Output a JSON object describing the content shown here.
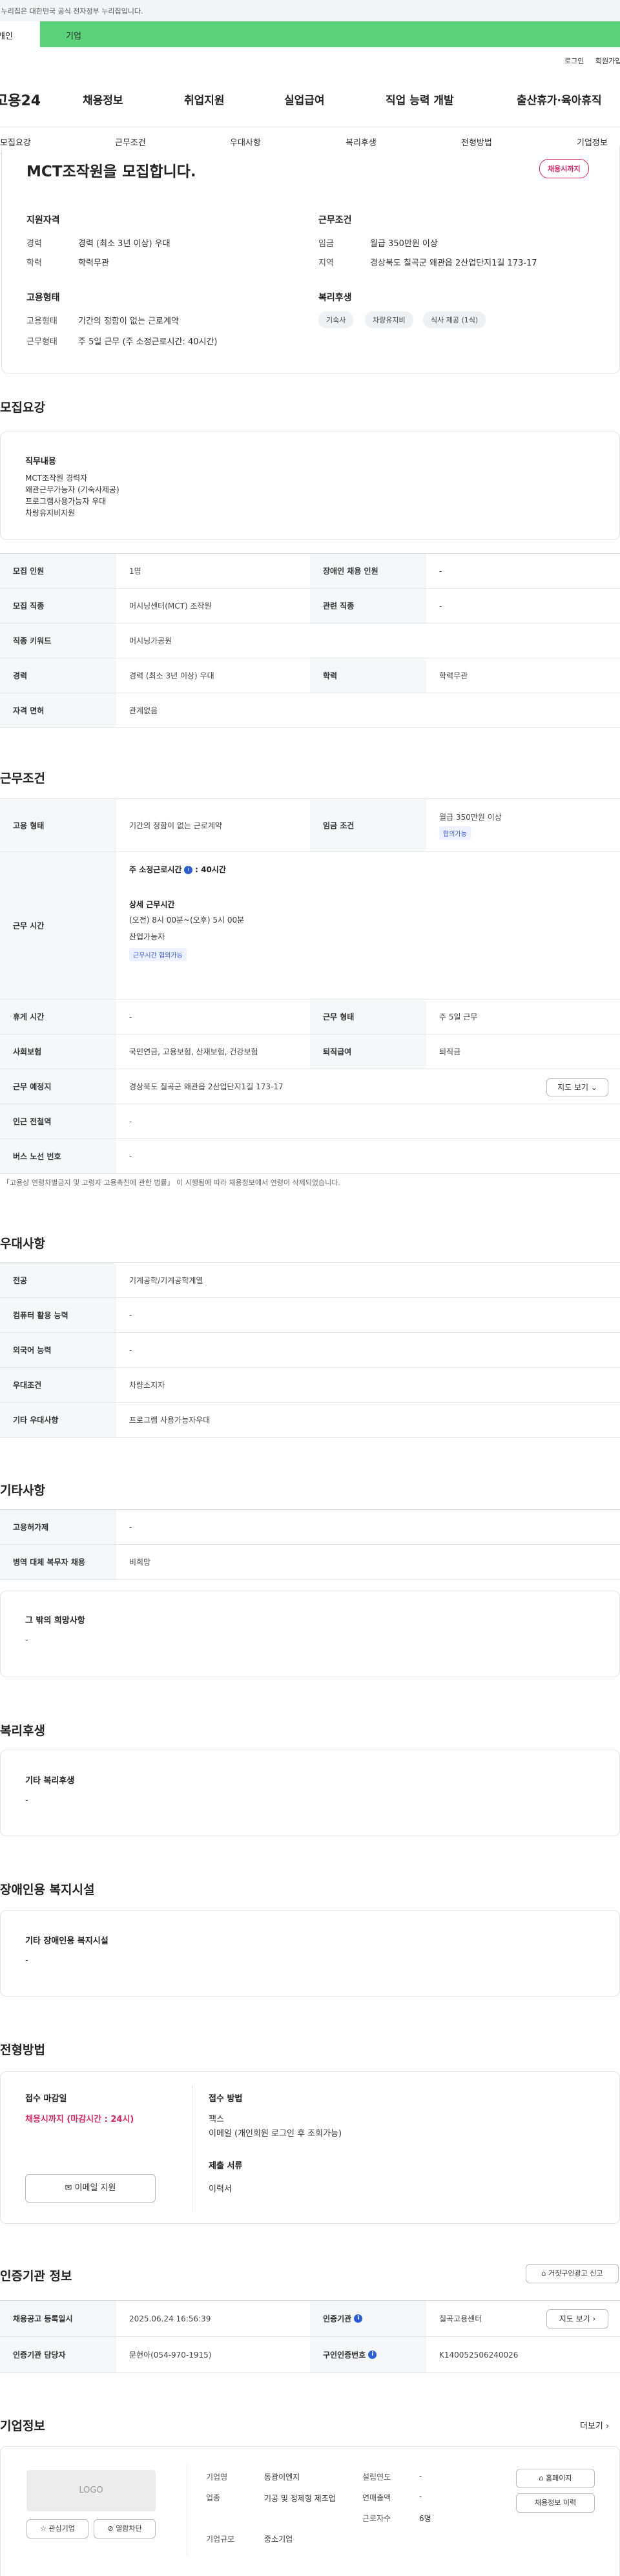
{
  "gov_bar": {
    "text": "이 누리집은 대한민국 공식 전자정부 누리집입니다."
  },
  "site_tabs": [
    "개인",
    "기업"
  ],
  "util_links": [
    "로그인",
    "회원가입"
  ],
  "gnb": {
    "logo": "고용24",
    "menus": [
      "채용정보",
      "취업지원",
      "실업급여",
      "직업 능력 개발",
      "출산휴가·육아휴직"
    ]
  },
  "anchor_tabs": [
    "모집요강",
    "근무조건",
    "우대사항",
    "복리후생",
    "전형방법",
    "기업정보"
  ],
  "summary": {
    "title": "MCT조작원을 모집합니다.",
    "badge": "채용시까지",
    "qual": {
      "heading": "지원자격",
      "rows": [
        {
          "label": "경력",
          "value": "경력 (최소 3년 이상) 우대"
        },
        {
          "label": "학력",
          "value": "학력무관"
        }
      ]
    },
    "cond": {
      "heading": "근무조건",
      "rows": [
        {
          "label": "임금",
          "value": "월급 350만원 이상"
        },
        {
          "label": "지역",
          "value": "경상북도 칠곡군 왜관읍 2산업단지1길 173-17"
        }
      ]
    },
    "emp": {
      "heading": "고용형태",
      "rows": [
        {
          "label": "고용형태",
          "value": "기간의 정함이 없는 근로계약"
        },
        {
          "label": "근무형태",
          "value": "주 5일 근무 (주 소정근로시간: 40시간)"
        }
      ]
    },
    "welfare": {
      "heading": "복리후생",
      "chips": [
        "기숙사",
        "차량유지비",
        "식사 제공 (1식)"
      ]
    }
  },
  "recruit": {
    "heading": "모집요강",
    "duty_title": "직무내용",
    "duty_lines": [
      "MCT조작원 경력자",
      "왜관근무가능자 (기숙사제공)",
      "프로그램사용가능자 우대",
      "차량유지비지원"
    ],
    "rows": [
      {
        "th1": "모집 인원",
        "td1": "1명",
        "th2": "장애인 채용 인원",
        "td2": "-"
      },
      {
        "th1": "모집 직종",
        "td1": "머시닝센터(MCT) 조작원",
        "th2": "관련 직종",
        "td2": "-"
      },
      {
        "th1": "직종 키워드",
        "td1": "머시닝가공원"
      },
      {
        "th1": "경력",
        "td1": "경력 (최소 3년 이상) 우대",
        "th2": "학력",
        "td2": "학력무관"
      },
      {
        "th1": "자격 면허",
        "td1": "관계없음"
      }
    ]
  },
  "work": {
    "heading": "근무조건",
    "emp_type_label": "고용 형태",
    "emp_type": "기간의 정함이 없는 근로계약",
    "wage_label": "임금 조건",
    "wage": "월급 350만원 이상",
    "wage_tag": "협의가능",
    "hours_label": "근무 시간",
    "hours_week": "주 소정근로시간",
    "hours_value": ": 40시간",
    "hours_detail_title": "상세 근무시간",
    "hours_detail": "(오전) 8시 00분~(오후) 5시 00분",
    "hours_extra": "잔업가능자",
    "hours_tag": "근무시간 협의가능",
    "rows": [
      {
        "th1": "휴게 시간",
        "td1": "-",
        "th2": "근무 형태",
        "td2": "주 5일 근무"
      },
      {
        "th1": "사회보험",
        "td1": "국민연금, 고용보험, 산재보험, 건강보험",
        "th2": "퇴직급여",
        "td2": "퇴직금"
      }
    ],
    "place_label": "근무 예정지",
    "place": "경상북도 칠곡군 왜관읍 2산업단지1길 173-17",
    "map_btn": "지도 보기",
    "station_label": "인근 전철역",
    "station": "-",
    "bus_label": "버스 노선 번호",
    "bus": "-",
    "note": "「고용상 연령차별금지 및 고령자 고용촉진에 관한 법률」 이 시행됨에 따라 채용정보에서 연령이 삭제되었습니다."
  },
  "prefer": {
    "heading": "우대사항",
    "rows": [
      {
        "th": "전공",
        "td": "기계공학/기계공학계열"
      },
      {
        "th": "컴퓨터 활용 능력",
        "td": "-"
      },
      {
        "th": "외국어 능력",
        "td": "-"
      },
      {
        "th": "우대조건",
        "td": "차량소지자"
      },
      {
        "th": "기타 우대사항",
        "td": "프로그램 사용가능자우대"
      }
    ]
  },
  "etc": {
    "heading": "기타사항",
    "rows": [
      {
        "th": "고용허가제",
        "td": "-"
      },
      {
        "th": "병역 대체 복무자 채용",
        "td": "비희망"
      }
    ],
    "box_title": "그 밖의 희망사항",
    "box_value": "-"
  },
  "benefit": {
    "heading": "복리후생",
    "box_title": "기타 복리후생",
    "box_value": "-"
  },
  "disabled": {
    "heading": "장애인용 복지시설",
    "box_title": "기타 장애인용 복지시설",
    "box_value": "-"
  },
  "process": {
    "heading": "전형방법",
    "deadline_title": "접수 마감일",
    "deadline": "채용시까지 (마감시간 : 24시)",
    "email_btn": "이메일 지원",
    "method_title": "접수 방법",
    "methods": [
      "팩스",
      "이메일 (개인회원 로그인 후 조회가능)"
    ],
    "docs_title": "제출 서류",
    "docs": "이력서"
  },
  "agency": {
    "heading": "인증기관 정보",
    "report_btn": "거짓구인광고 신고",
    "rows": [
      {
        "th1": "채용공고 등록일시",
        "td1": "2025.06.24 16:56:39",
        "th2": "인증기관",
        "td2": "칠곡고용센터",
        "btn": "지도 보기"
      },
      {
        "th1": "인증기관 담당자",
        "td1": "문현아(054-970-1915)",
        "th2": "구인인증번호",
        "td2": "K140052506240026"
      }
    ]
  },
  "company": {
    "heading": "기업정보",
    "more": "더보기",
    "logo": "LOGO",
    "fav_btn": "관심기업",
    "block_btn": "열람차단",
    "info": [
      {
        "label": "기업명",
        "value": "동광이엔지"
      },
      {
        "label": "업종",
        "value": "기공 및 정제형 제조업"
      },
      {
        "label": "기업규모",
        "value": "중소기업"
      }
    ],
    "info2": [
      {
        "label": "설립연도",
        "value": "-"
      },
      {
        "label": "연매출액",
        "value": "-"
      },
      {
        "label": "근로자수",
        "value": "6명"
      }
    ],
    "home_btn": "홈페이지",
    "history_btn": "채용정보 이력"
  }
}
